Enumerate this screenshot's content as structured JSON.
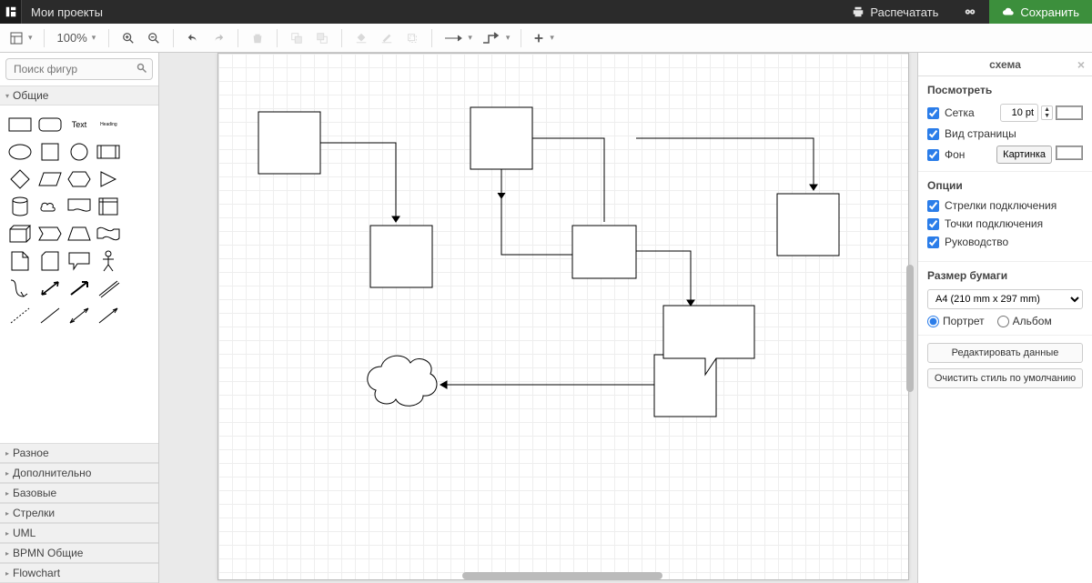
{
  "topbar": {
    "title": "Мои проекты",
    "print": "Распечатать",
    "save": "Сохранить"
  },
  "toolbar": {
    "zoom": "100%"
  },
  "sidebar": {
    "search_placeholder": "Поиск фигур",
    "general": "Общие",
    "text_shape": "Text",
    "heading_shape": "Heading",
    "categories": [
      "Разное",
      "Дополнительно",
      "Базовые",
      "Стрелки",
      "UML",
      "BPMN Общие",
      "Flowchart"
    ]
  },
  "right": {
    "panel_title": "схема",
    "section_view": "Посмотреть",
    "grid": "Сетка",
    "grid_value": "10 pt",
    "page_view": "Вид страницы",
    "background": "Фон",
    "image_btn": "Картинка",
    "section_options": "Опции",
    "conn_arrows": "Стрелки подключения",
    "conn_points": "Точки подключения",
    "guides": "Руководство",
    "section_paper": "Размер бумаги",
    "paper_size": "A4 (210 mm x 297 mm)",
    "portrait": "Портрет",
    "landscape": "Альбом",
    "edit_data": "Редактировать данные",
    "clear_style": "Очистить стиль по умолчанию"
  }
}
